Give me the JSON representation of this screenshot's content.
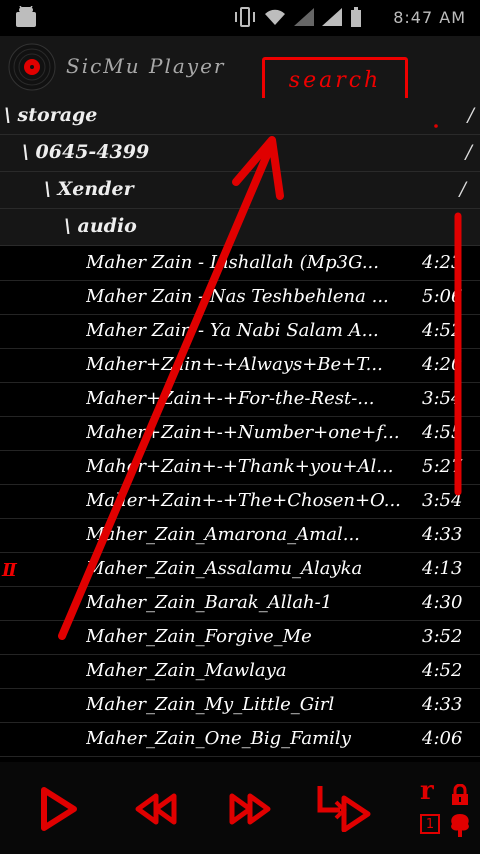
{
  "status": {
    "time": "8:47 AM"
  },
  "app": {
    "title": "SicMu Player",
    "search_label": "search"
  },
  "folders": [
    {
      "label": "\\ storage",
      "slash": "/"
    },
    {
      "label": "\\ 0645-4399",
      "slash": "/"
    },
    {
      "label": "\\ Xender",
      "slash": "/"
    },
    {
      "label": "\\ audio",
      "slash": ""
    }
  ],
  "tracks": [
    {
      "title": "Maher Zain - Inshallah (Mp3G...",
      "duration": "4:23"
    },
    {
      "title": "Maher Zain - Nas Teshbehlena ...",
      "duration": "5:06"
    },
    {
      "title": "Maher Zain - Ya Nabi Salam A...",
      "duration": "4:52"
    },
    {
      "title": "Maher+Zain+-+Always+Be+T...",
      "duration": "4:20"
    },
    {
      "title": "Maher+Zain+-+For-the-Rest-...",
      "duration": "3:54"
    },
    {
      "title": "Maher+Zain+-+Number+one+f...",
      "duration": "4:55"
    },
    {
      "title": "Maher+Zain+-+Thank+you+Al...",
      "duration": "5:27"
    },
    {
      "title": "Maher+Zain+-+The+Chosen+O...",
      "duration": "3:54"
    },
    {
      "title": "Maher_Zain_Amarona_Amal...",
      "duration": "4:33"
    },
    {
      "title": "Maher_Zain_Assalamu_Alayka",
      "duration": "4:13",
      "playing_indicator": "II"
    },
    {
      "title": "Maher_Zain_Barak_Allah-1",
      "duration": "4:30"
    },
    {
      "title": "Maher_Zain_Forgive_Me",
      "duration": "3:52"
    },
    {
      "title": "Maher_Zain_Mawlaya",
      "duration": "4:52"
    },
    {
      "title": "Maher_Zain_My_Little_Girl",
      "duration": "4:33"
    },
    {
      "title": "Maher_Zain_One_Big_Family",
      "duration": "4:06"
    }
  ],
  "controls": {
    "repeat_label": "r",
    "repeat_one_label": "1",
    "icons": [
      "play-icon",
      "rewind-icon",
      "fast-forward-icon",
      "next-track-icon",
      "lock-icon",
      "tree-icon"
    ]
  },
  "colors": {
    "accent": "#e00000",
    "appbar": "#161616",
    "background": "#000000"
  }
}
